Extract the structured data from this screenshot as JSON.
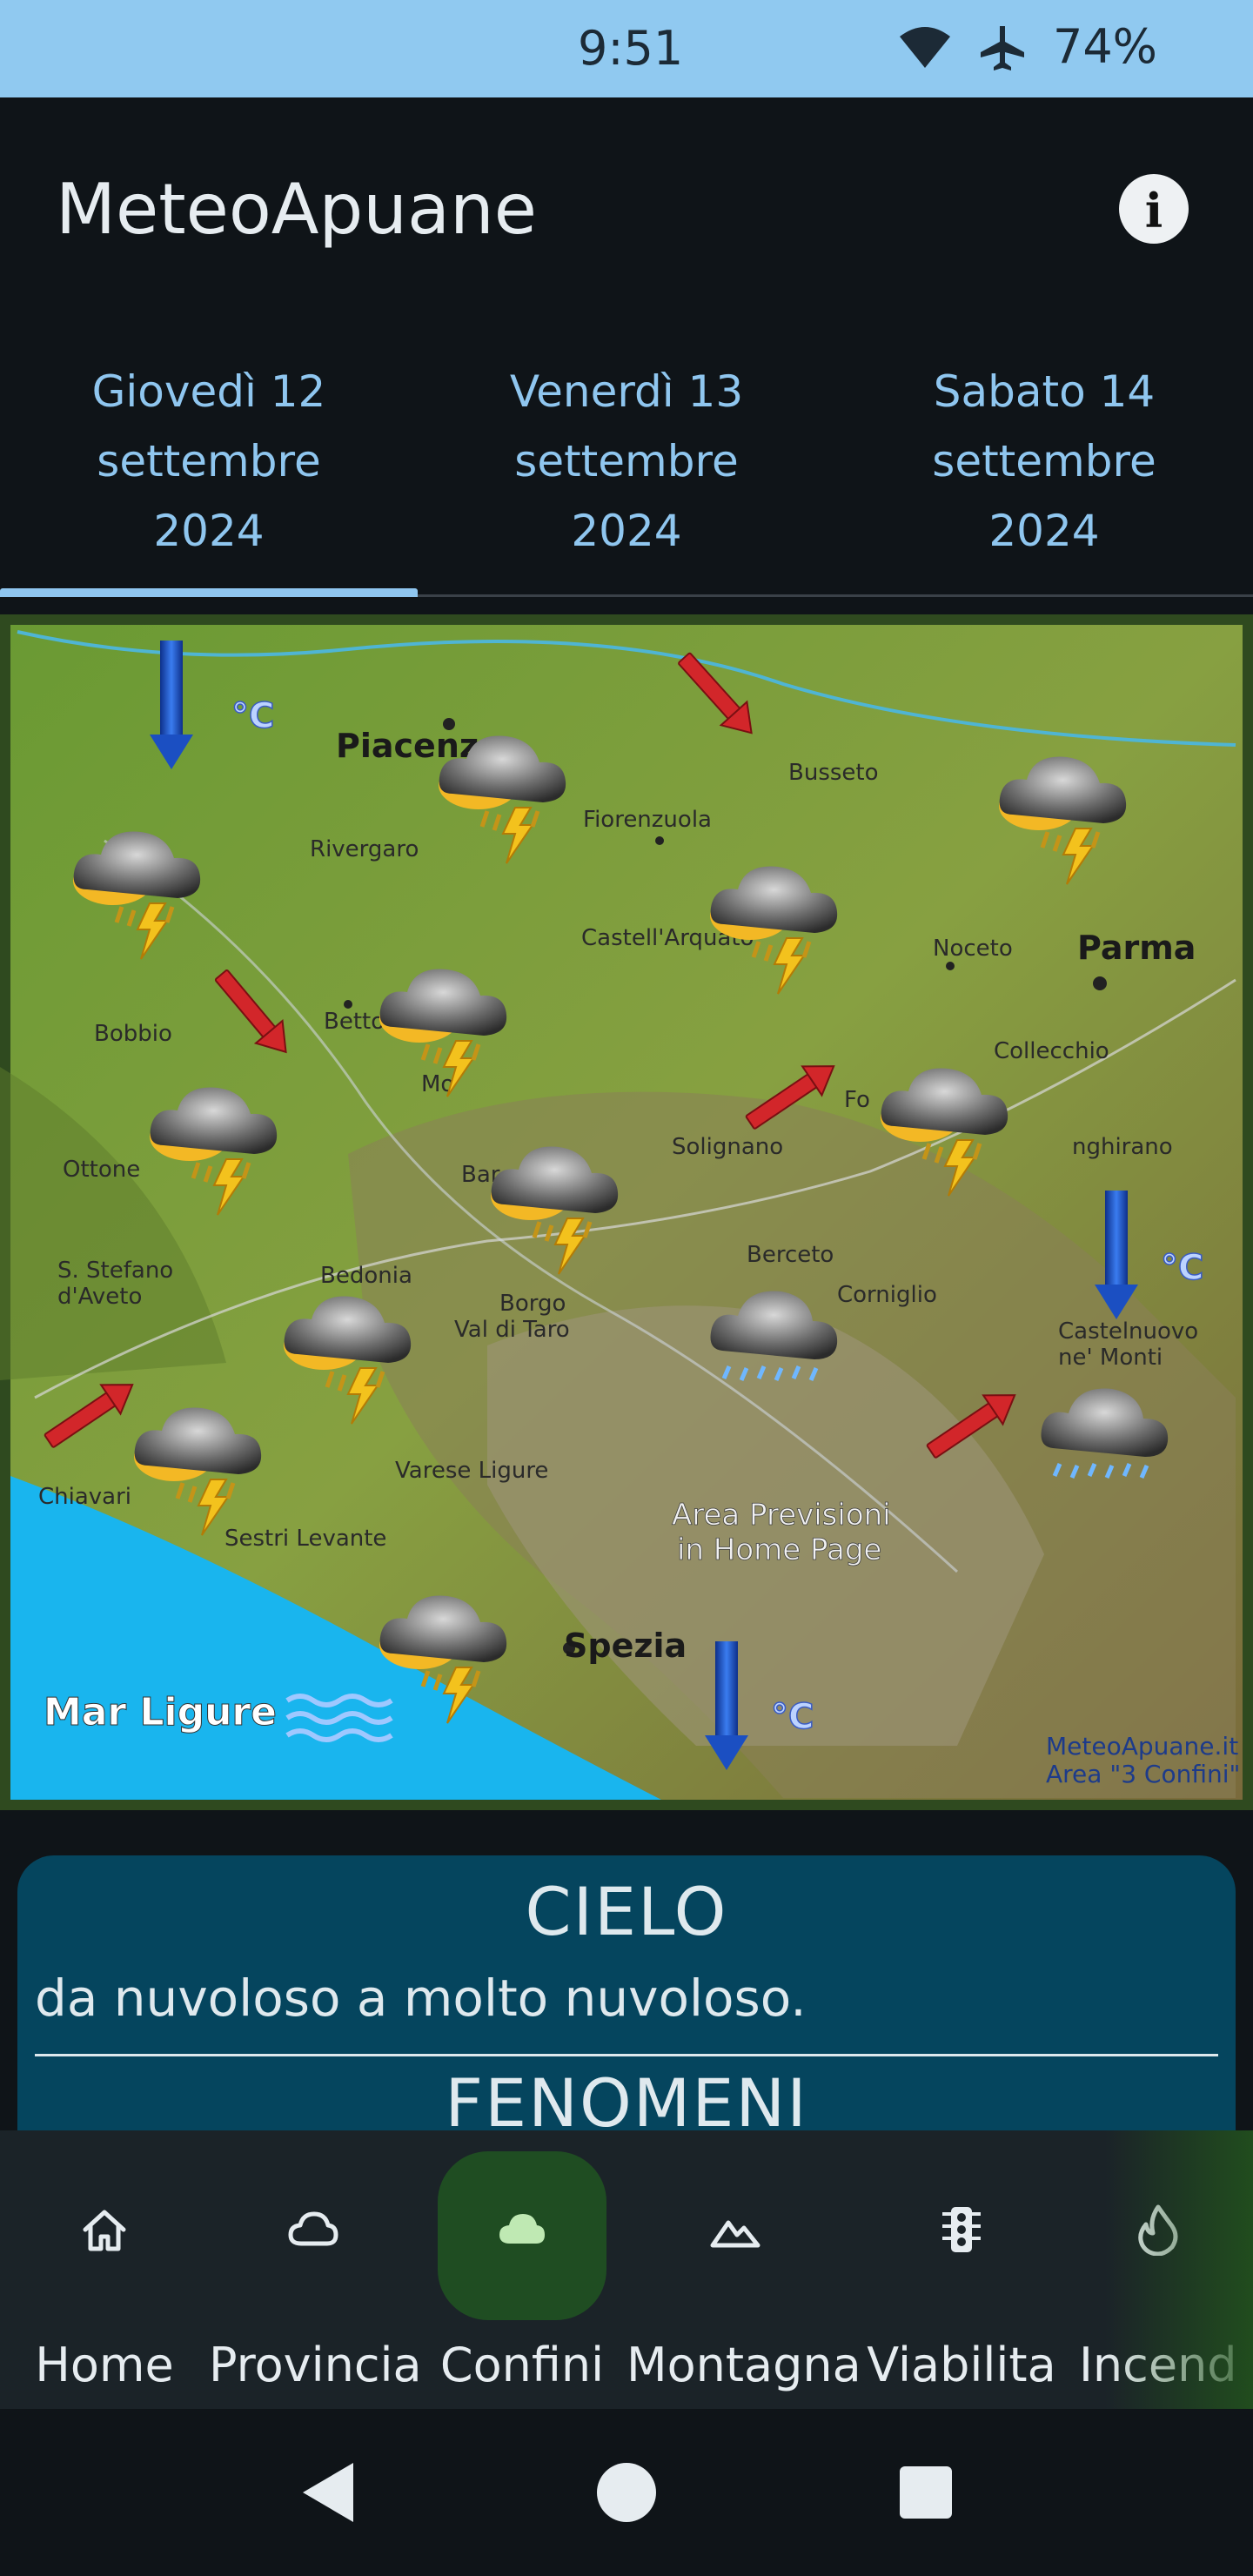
{
  "status_bar": {
    "time": "9:51",
    "battery": "74%"
  },
  "app": {
    "title": "MeteoApuane"
  },
  "tabs": [
    {
      "line1": "Giovedì 12",
      "line2": "settembre",
      "line3": "2024",
      "active": true
    },
    {
      "line1": "Venerdì 13",
      "line2": "settembre",
      "line3": "2024",
      "active": false
    },
    {
      "line1": "Sabato 14",
      "line2": "settembre",
      "line3": "2024",
      "active": false
    }
  ],
  "map": {
    "places": {
      "piacenza": "Piacenza",
      "busseto": "Busseto",
      "fiorenzuola": "Fiorenzuola",
      "rivergaro": "Rivergaro",
      "castellarquato": "Castell'Arquato",
      "parma": "Parma",
      "noceto": "Noceto",
      "bobbio": "Bobbio",
      "bettola": "Betto",
      "collecchio": "Collecchio",
      "morfasso": "Mo",
      "fornovo": "Fo",
      "solignano": "Solignano",
      "langhirano": "nghirano",
      "ottone": "Ottone",
      "bardi": "Bar",
      "bedonia": "Bedonia",
      "berceto": "Berceto",
      "stefano1": "S. Stefano",
      "stefano2": "d'Aveto",
      "borgo1": "Borgo",
      "borgo2": "Val di Taro",
      "corniglio": "Corniglio",
      "castelnuovo1": "Castelnuovo",
      "castelnuovo2": "ne' Monti",
      "varese": "Varese Ligure",
      "chiavari": "Chiavari",
      "sestri": "Sestri Levante",
      "spezia": "Spezia",
      "area1": "Area Previsioni",
      "area2": "in Home Page",
      "sea": "Mar Ligure",
      "credit1": "MeteoApuane.it",
      "credit2": "Area \"3 Confini\"",
      "deg": "°C"
    },
    "colors": {
      "land": "#5f8a2e",
      "hills": "#8a8a4a",
      "sea": "#19b5ee",
      "arrow_blue": "#1a56c8",
      "arrow_red": "#d2262a"
    }
  },
  "card": {
    "title": "CIELO",
    "text": "da nuvoloso a molto nuvoloso.",
    "next_title": "FENOMENI"
  },
  "nav": {
    "items": [
      {
        "label": "Home",
        "icon": "home-icon"
      },
      {
        "label": "Provincia",
        "icon": "cloud-outline-icon"
      },
      {
        "label": "Confini",
        "icon": "cloud-filled-icon",
        "selected": true
      },
      {
        "label": "Montagna",
        "icon": "mountain-icon"
      },
      {
        "label": "Viabilita",
        "icon": "traffic-light-icon"
      },
      {
        "label": "Incend",
        "icon": "fire-icon"
      }
    ]
  }
}
